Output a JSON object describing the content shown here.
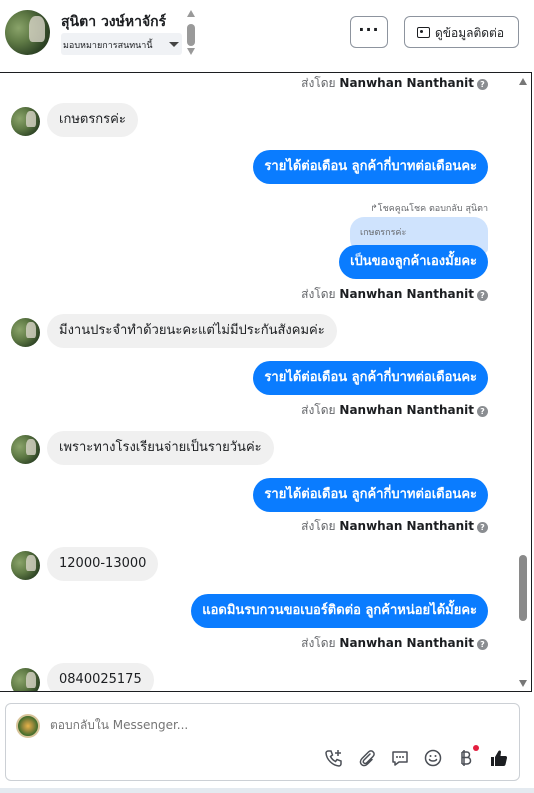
{
  "header": {
    "name": "สุนิตา วงษ์หาจักร์",
    "assign_label": "มอบหมายการสนทนานี้",
    "more_label": "···",
    "contact_label": "ดูข้อมูลติดต่อ"
  },
  "chat": {
    "sent_by_prefix": "ส่งโดย",
    "sender": "Nanwhan Nanthanit",
    "info_glyph": "?",
    "reply_meta": "↱โชคคูณโชค ตอบกลับ สุนิตา",
    "quoted_text": "เกษตรกรค่ะ",
    "messages": [
      {
        "side": "in",
        "text": "เกษตรกรค่ะ"
      },
      {
        "side": "out",
        "text": "รายได้ต่อเดือน ลูกค้ากี่บาทต่อเดือนคะ"
      },
      {
        "side": "out",
        "text": "เป็นของลูกค้าเองมั้ยคะ"
      },
      {
        "side": "in",
        "text": "มีงานประจำทำด้วยนะคะแต่ไม่มีประกันสังคมค่ะ"
      },
      {
        "side": "out",
        "text": "รายได้ต่อเดือน ลูกค้ากี่บาทต่อเดือนคะ"
      },
      {
        "side": "in",
        "text": "เพราะทางโรงเรียนจ่ายเป็นรายวันค่ะ"
      },
      {
        "side": "out",
        "text": "รายได้ต่อเดือน ลูกค้ากี่บาทต่อเดือนคะ"
      },
      {
        "side": "in",
        "text": "12000-13000"
      },
      {
        "side": "out",
        "text": "แอดมินรบกวนขอเบอร์ติดต่อ ลูกค้าหน่อยได้มั้ยคะ"
      },
      {
        "side": "in",
        "text": "0840025175"
      }
    ]
  },
  "composer": {
    "placeholder": "ตอบกลับใน Messenger...",
    "tools": [
      "phone-add-icon",
      "paperclip-icon",
      "saved-reply-icon",
      "emoji-icon",
      "baht-icon",
      "like-icon"
    ]
  }
}
